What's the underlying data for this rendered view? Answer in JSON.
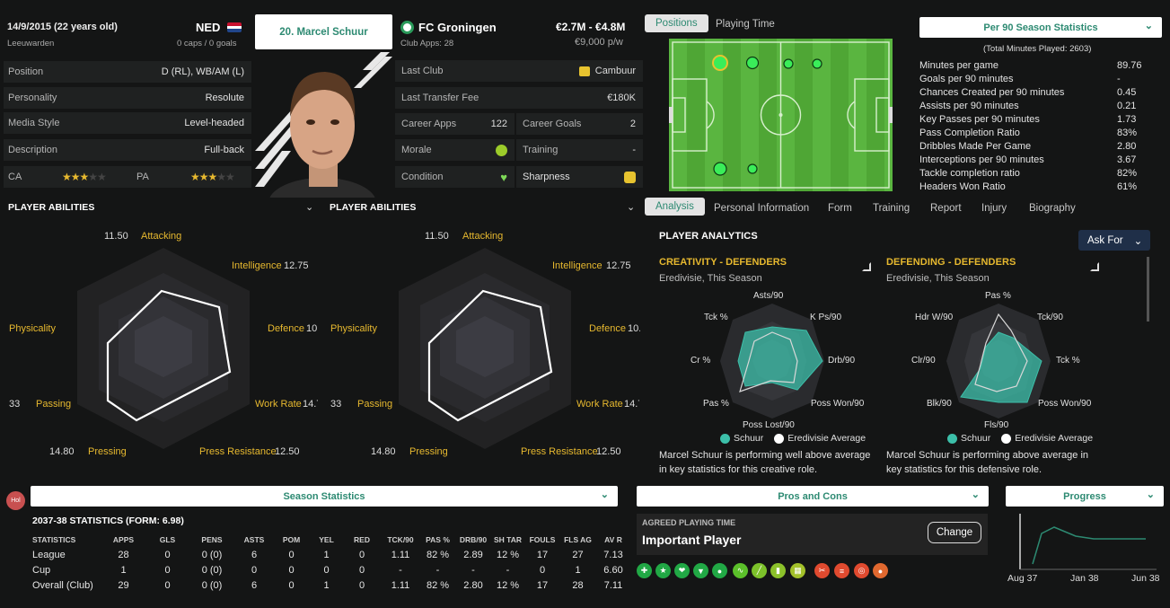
{
  "player": {
    "dob": "14/9/2015 (22 years old)",
    "nation": "NED",
    "birthplace": "Leeuwarden",
    "caps": "0 caps / 0 goals",
    "name": "20. Marcel Schuur"
  },
  "info": [
    {
      "label": "Position",
      "value": "D (RL), WB/AM (L)"
    },
    {
      "label": "Personality",
      "value": "Resolute"
    },
    {
      "label": "Media Style",
      "value": "Level-headed"
    },
    {
      "label": "Description",
      "value": "Full-back"
    }
  ],
  "ability": {
    "ca_label": "CA",
    "pa_label": "PA",
    "ca_stars": 3,
    "pa_stars": 3
  },
  "club": {
    "name": "FC Groningen",
    "apps": "Club Apps: 28",
    "value": "€2.7M - €4.8M",
    "wage": "€9,000 p/w",
    "last_club_label": "Last Club",
    "last_club": "Cambuur",
    "transfer_label": "Last Transfer Fee",
    "transfer": "€180K",
    "career_apps_label": "Career Apps",
    "career_apps": "122",
    "career_goals_label": "Career Goals",
    "career_goals": "2",
    "morale_label": "Morale",
    "training_label": "Training",
    "training": "-",
    "condition_label": "Condition",
    "sharpness_label": "Sharpness"
  },
  "abilities_panels": [
    {
      "title": "PLAYER ABILITIES",
      "attacking": "Attacking",
      "attacking_v": "11.50",
      "intelligence": "Intelligence",
      "intelligence_v": "12.75",
      "defence": "Defence",
      "defence_v": "10",
      "work": "Work Rate",
      "work_v": "14.7",
      "press_res": "Press Resistance",
      "press_res_v": "12.50",
      "pressing": "Pressing",
      "pressing_v": "14.80",
      "passing": "Passing",
      "passing_v": "33",
      "physicality": "Physicality"
    },
    {
      "title": "PLAYER ABILITIES",
      "attacking": "Attacking",
      "attacking_v": "11.50",
      "intelligence": "Intelligence",
      "intelligence_v": "12.75",
      "defence": "Defence",
      "defence_v": "10.",
      "work": "Work Rate",
      "work_v": "14.7",
      "press_res": "Press Resistance",
      "press_res_v": "12.50",
      "pressing": "Pressing",
      "pressing_v": "14.80",
      "passing": "Passing",
      "passing_v": "33",
      "physicality": "Physicality"
    }
  ],
  "pitch_tabs": [
    "Positions",
    "Playing Time"
  ],
  "per90": {
    "header": "Per 90 Season Statistics",
    "total": "(Total Minutes Played: 2603)",
    "rows": [
      {
        "label": "Minutes per game",
        "value": "89.76"
      },
      {
        "label": "Goals per 90 minutes",
        "value": "-"
      },
      {
        "label": "Chances Created per 90 minutes",
        "value": "0.45"
      },
      {
        "label": "Assists per 90 minutes",
        "value": "0.21"
      },
      {
        "label": "Key Passes per 90 minutes",
        "value": "1.73"
      },
      {
        "label": "Pass Completion Ratio",
        "value": "83%"
      },
      {
        "label": "Dribbles Made Per Game",
        "value": "2.80"
      },
      {
        "label": "Interceptions per 90 minutes",
        "value": "3.67"
      },
      {
        "label": "Tackle completion ratio",
        "value": "82%"
      },
      {
        "label": "Headers Won Ratio",
        "value": "61%"
      }
    ]
  },
  "analysis_tabs": [
    "Analysis",
    "Personal Information",
    "Form",
    "Training",
    "Report",
    "Injury",
    "Biography"
  ],
  "analytics": {
    "title": "PLAYER ANALYTICS",
    "ask": "Ask For",
    "creativity": {
      "title": "CREATIVITY - DEFENDERS",
      "sub": "Eredivisie, This Season",
      "labels": [
        "Asts/90",
        "K Ps/90",
        "Drb/90",
        "Poss Won/90",
        "Poss Lost/90",
        "Pas %",
        "Cr %",
        "Tck %"
      ],
      "desc": "Marcel Schuur is performing well above average in key statistics for this creative role."
    },
    "defending": {
      "title": "DEFENDING - DEFENDERS",
      "sub": "Eredivisie, This Season",
      "labels": [
        "Pas %",
        "Tck/90",
        "Tck %",
        "Poss Won/90",
        "Fls/90",
        "Blk/90",
        "Clr/90",
        "Hdr W/90"
      ],
      "desc": "Marcel Schuur is performing above average in key statistics for this defensive role."
    },
    "legend_player": "Schuur",
    "legend_avg": "Eredivisie Average"
  },
  "season": {
    "header": "Season Statistics",
    "badge": "Hol",
    "title": "2037-38 STATISTICS (FORM: 6.98)",
    "columns": [
      "STATISTICS",
      "APPS",
      "GLS",
      "PENS",
      "ASTS",
      "POM",
      "YEL",
      "RED",
      "TCK/90",
      "PAS %",
      "DRB/90",
      "SH TAR",
      "FOULS",
      "FLS AG",
      "AV R"
    ],
    "rows": [
      [
        "League",
        "28",
        "0",
        "0 (0)",
        "6",
        "0",
        "1",
        "0",
        "1.11",
        "82 %",
        "2.89",
        "12 %",
        "17",
        "27",
        "7.13"
      ],
      [
        "Cup",
        "1",
        "0",
        "0 (0)",
        "0",
        "0",
        "0",
        "0",
        "-",
        "-",
        "-",
        "-",
        "0",
        "1",
        "6.60"
      ],
      [
        "Overall (Club)",
        "29",
        "0",
        "0 (0)",
        "6",
        "0",
        "1",
        "0",
        "1.11",
        "82 %",
        "2.80",
        "12 %",
        "17",
        "28",
        "7.11"
      ]
    ]
  },
  "pros": {
    "header": "Pros and Cons",
    "pt_label": "AGREED PLAYING TIME",
    "pt_value": "Important Player",
    "change": "Change"
  },
  "progress": {
    "header": "Progress",
    "x_labels": [
      "Aug 37",
      "Jan 38",
      "Jun 38"
    ]
  },
  "colors": {
    "accent": "#2d8a72",
    "gold": "#e7b92f",
    "teal": "#3cbfa9"
  }
}
